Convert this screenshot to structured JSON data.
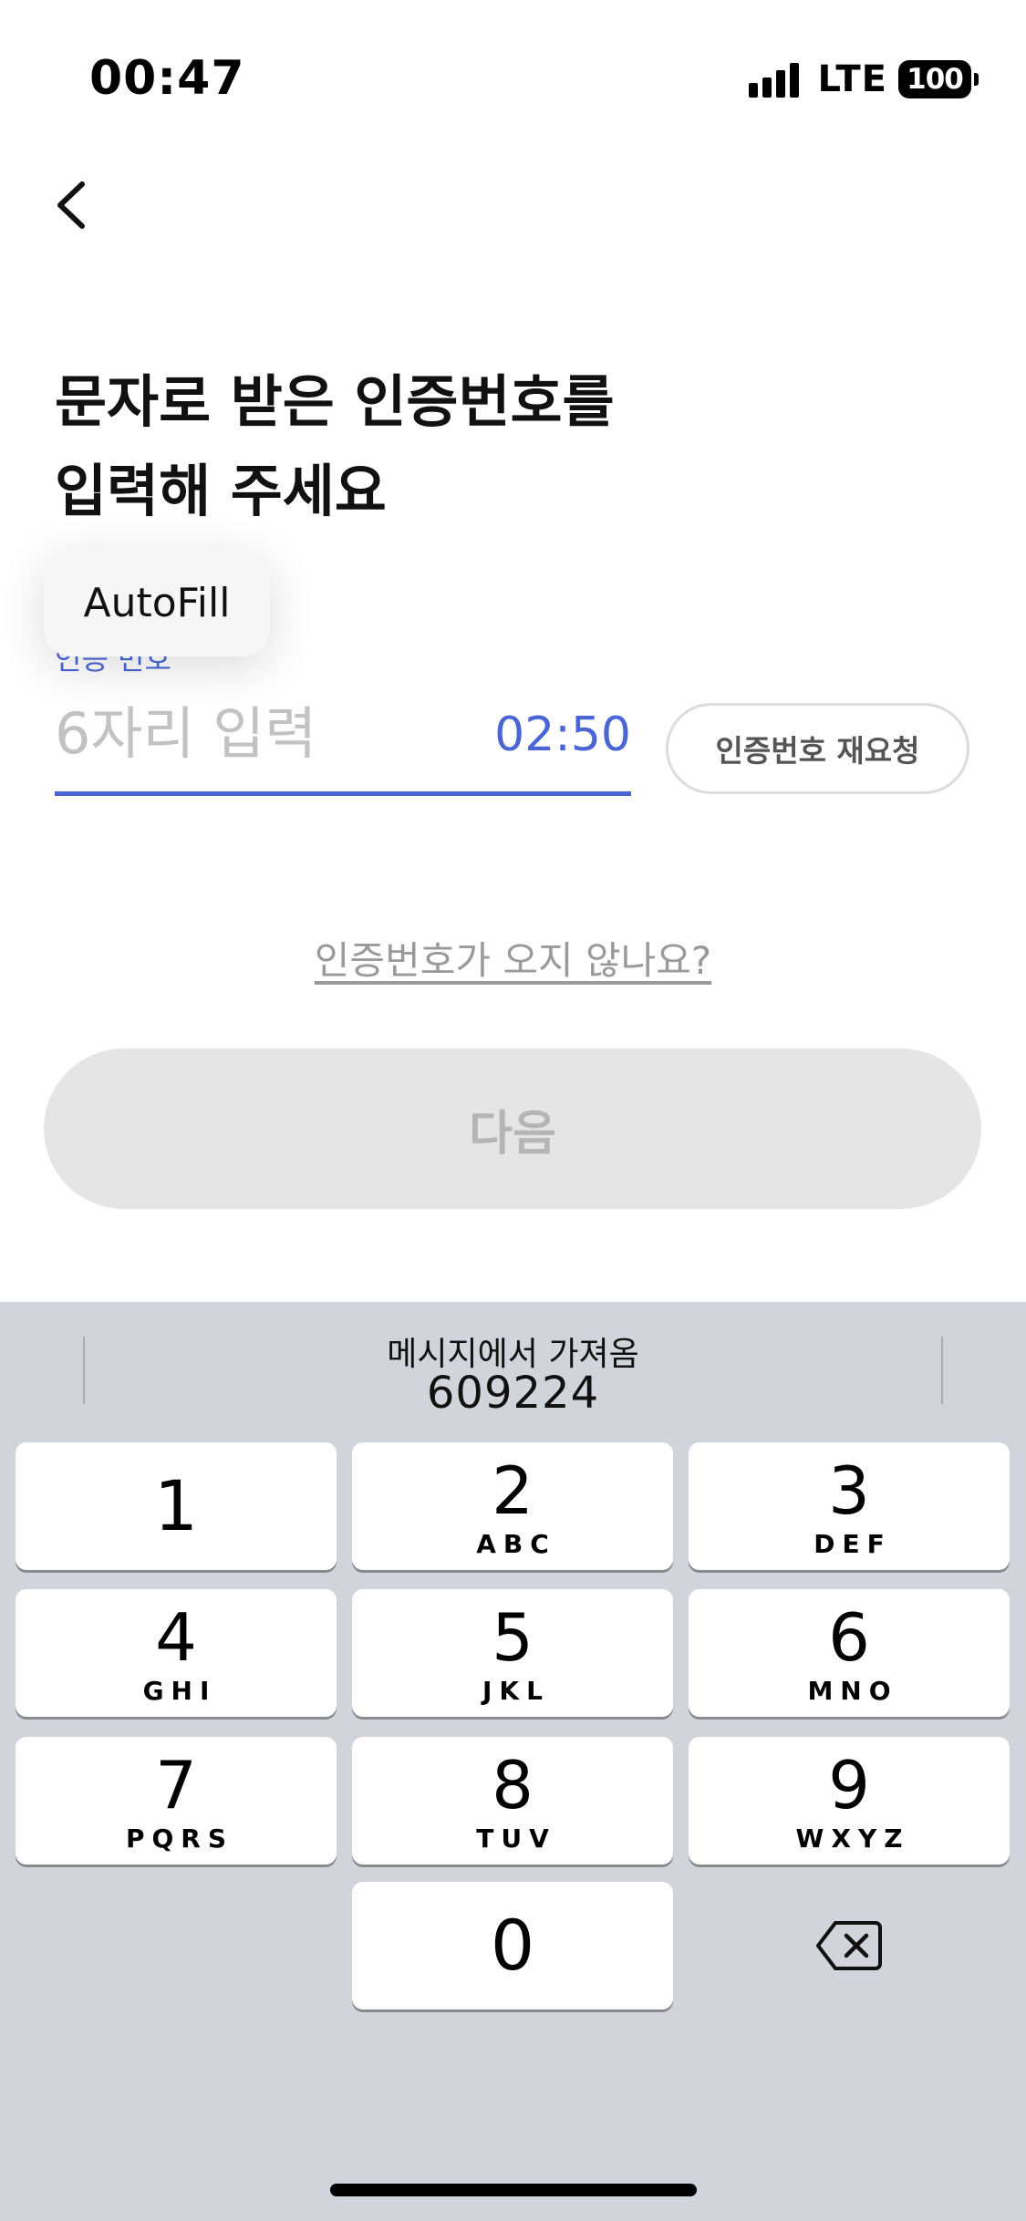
{
  "status_bar": {
    "time": "00:47",
    "network": "LTE",
    "battery": "100"
  },
  "heading": {
    "line1": "문자로 받은 인증번호를",
    "line2": "입력해 주세요"
  },
  "autofill": {
    "label": "AutoFill"
  },
  "field": {
    "label": "인증 번호",
    "placeholder": "6자리 입력",
    "value": "",
    "timer": "02:50",
    "resend_label": "인증번호 재요청"
  },
  "help_link": "인증번호가 오지 않나요?",
  "next_button": "다음",
  "keyboard": {
    "suggestion_label": "메시지에서 가져옴",
    "suggestion_code": "609224",
    "keys": [
      {
        "digit": "1",
        "letters": ""
      },
      {
        "digit": "2",
        "letters": "ABC"
      },
      {
        "digit": "3",
        "letters": "DEF"
      },
      {
        "digit": "4",
        "letters": "GHI"
      },
      {
        "digit": "5",
        "letters": "JKL"
      },
      {
        "digit": "6",
        "letters": "MNO"
      },
      {
        "digit": "7",
        "letters": "PQRS"
      },
      {
        "digit": "8",
        "letters": "TUV"
      },
      {
        "digit": "9",
        "letters": "WXYZ"
      },
      {
        "digit": "0",
        "letters": ""
      }
    ],
    "delete_icon": "backspace-icon"
  },
  "colors": {
    "accent": "#4a66d6",
    "keyboard_bg": "#d2d4db",
    "disabled_button": "#e5e5e5",
    "disabled_text": "#b5b5b5"
  }
}
